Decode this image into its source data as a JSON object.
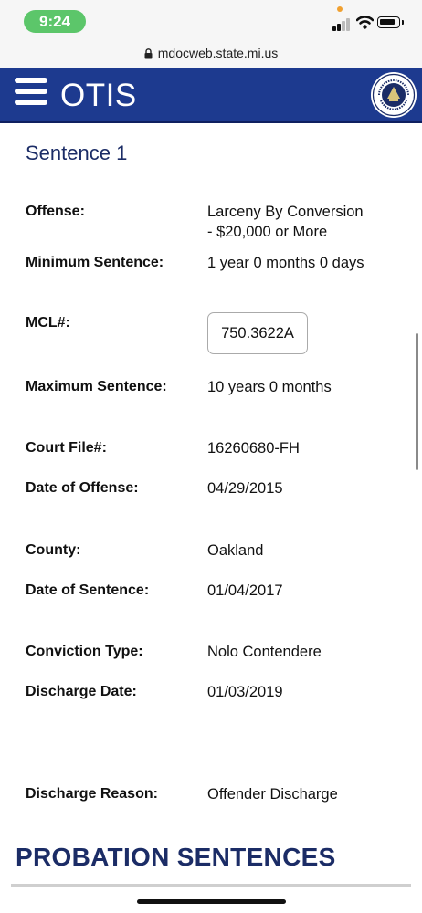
{
  "status": {
    "time": "9:24",
    "icons": [
      "signal-icon",
      "wifi-icon",
      "battery-icon"
    ]
  },
  "browser": {
    "url": "mdocweb.state.mi.us",
    "lock_icon": "lock-icon"
  },
  "header": {
    "app_title": "OTIS",
    "menu_icon": "hamburger-menu-icon",
    "seal_icon": "department-of-corrections-seal-icon",
    "seal_text": "DEPARTMENT OF CORRECTIONS · MICHIGAN",
    "background_color": "#1d3a8f"
  },
  "sentence": {
    "title": "Sentence 1",
    "offense_label": "Offense:",
    "offense_line1": "Larceny By Conversion",
    "offense_line2": "- $20,000 or More",
    "min_label": "Minimum Sentence:",
    "min_value": "1 year 0 months 0 days",
    "mcl_label": "MCL#:",
    "mcl_value": "750.3622A",
    "max_label": "Maximum Sentence:",
    "max_value": "10 years 0 months",
    "court_label": "Court File#:",
    "court_value": "16260680-FH",
    "doo_label": "Date of Offense:",
    "doo_value": "04/29/2015",
    "county_label": "County:",
    "county_value": "Oakland",
    "dos_label": "Date of Sentence:",
    "dos_value": "01/04/2017",
    "conv_label": "Conviction Type:",
    "conv_value": "Nolo Contendere",
    "dd_label": "Discharge Date:",
    "dd_value": "01/03/2019",
    "dr_label": "Discharge Reason:",
    "dr_value": "Offender Discharge"
  },
  "probation": {
    "title": "PROBATION SENTENCES"
  }
}
